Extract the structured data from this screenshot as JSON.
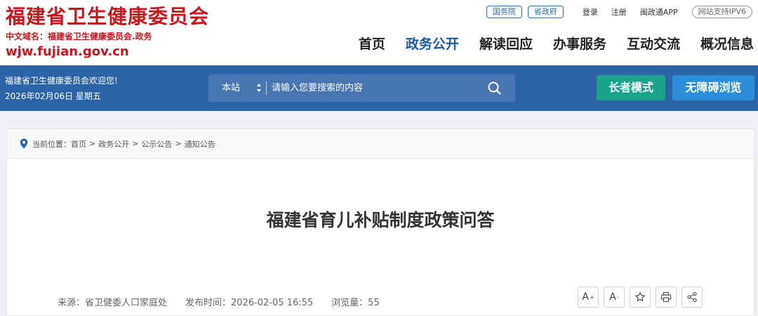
{
  "header": {
    "logo_title": "福建省卫生健康委员会",
    "logo_domain": "中文域名：福建省卫生健康委员会.政务",
    "logo_url": "wjw.fujian.gov.cn",
    "top_links": {
      "gov_council": "国务院",
      "province_gov": "省政府",
      "login": "登录",
      "register": "注册",
      "app": "闽政通APP",
      "ipv6": "网站支持IPV6"
    },
    "nav": [
      {
        "label": "首页",
        "active": false
      },
      {
        "label": "政务公开",
        "active": true
      },
      {
        "label": "解读回应",
        "active": false
      },
      {
        "label": "办事服务",
        "active": false
      },
      {
        "label": "互动交流",
        "active": false
      },
      {
        "label": "概况信息",
        "active": false
      }
    ]
  },
  "bluebar": {
    "welcome": "福建省卫生健康委员会欢迎您!",
    "date": "2026年02月06日 星期五",
    "search": {
      "scope": "本站",
      "placeholder": "请输入您要搜索的内容"
    },
    "elder_mode": "长者模式",
    "accessible": "无障碍浏览"
  },
  "breadcrumb": {
    "prefix": "当前位置：",
    "items": [
      "首页",
      "政务公开",
      "公示公告",
      "通知公告"
    ]
  },
  "article": {
    "title": "福建省育儿补贴制度政策问答",
    "source": "来源：省卫健委人口家庭处",
    "published": "发布时间：2026-02-05 16:55",
    "views": "浏览量：55"
  },
  "tools": {
    "font_increase": "A",
    "font_decrease": "A",
    "font_increase_sup": "+",
    "font_decrease_sup": "-",
    "icons": [
      "star-icon",
      "printer-icon",
      "share-icon"
    ]
  },
  "colors": {
    "brand_red": "#c8161d",
    "brand_blue": "#2c64a8",
    "nav_active": "#1a5a9e",
    "elder_green": "#1aa38a",
    "access_blue": "#2a8ed8"
  }
}
